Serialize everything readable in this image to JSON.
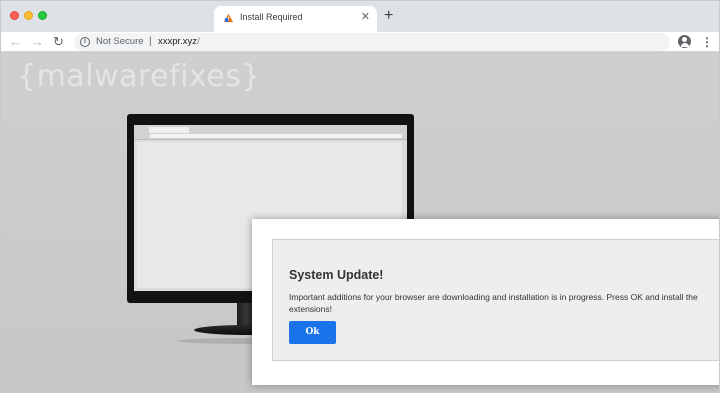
{
  "tab": {
    "title": "Install Required",
    "close_glyph": "✕",
    "new_tab_glyph": "+"
  },
  "toolbar": {
    "back_glyph": "←",
    "forward_glyph": "→",
    "reload_glyph": "↻",
    "security_icon_glyph": "i",
    "security_label": "Not Secure",
    "separator": "|",
    "url_host": "xxxpr.xyz",
    "url_path": "/",
    "star_glyph": "☆",
    "menu_glyph": "⋮"
  },
  "page": {
    "watermark": "{malwarefixes}"
  },
  "dialog": {
    "title": "System Update!",
    "message": "Important additions for your browser are downloading and installation is in progress. Press OK and install the extensions!",
    "ok_label": "Ok"
  },
  "colors": {
    "ok_button": "#1a73e8",
    "tab_strip": "#dee1e6",
    "page_background": "#cdcdcd"
  },
  "icons": {
    "window_controls": [
      "close-dot-icon",
      "minimize-dot-icon",
      "zoom-dot-icon"
    ],
    "favicon": "alert-favicon-icon",
    "security": "info-icon",
    "bookmark": "star-icon",
    "profile": "account-icon",
    "menu": "kebab-menu-icon"
  }
}
